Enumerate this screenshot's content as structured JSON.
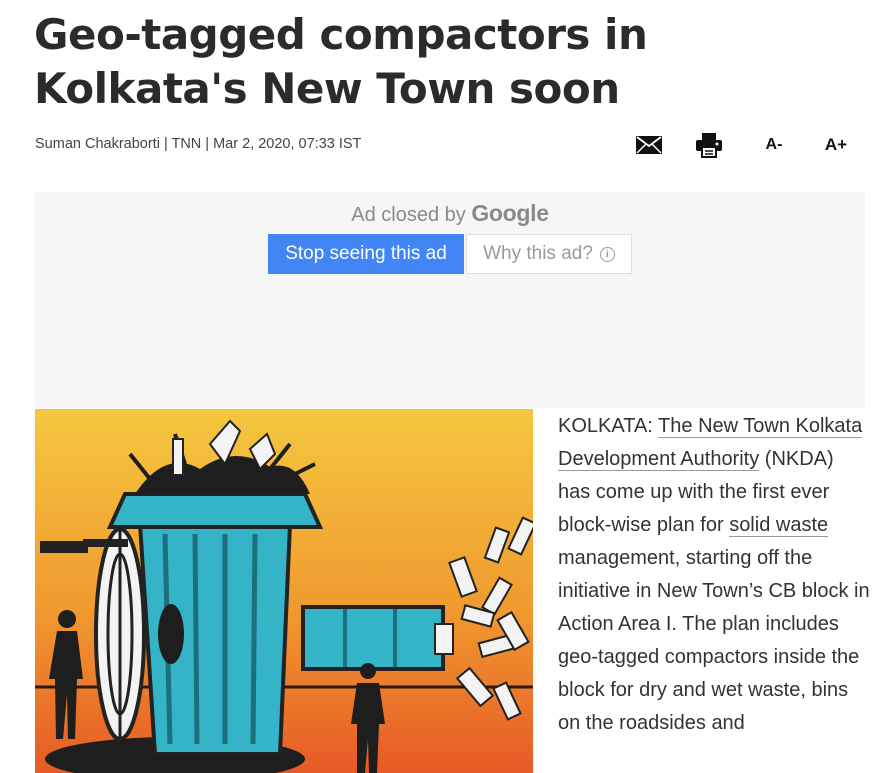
{
  "article": {
    "headline": "Geo-tagged compactors in Kolkata's New Town soon",
    "byline": "Suman Chakraborti | TNN | Mar 2, 2020, 07:33 IST",
    "body_parts": {
      "p1": "KOLKATA: ",
      "link1": "The New Town Kolkata Development Authority",
      "p2": " (NKDA) has come up with the first ever block-wise plan for ",
      "link2": "solid waste",
      "p3": " management, starting off the initiative in New Town’s CB block in Action Area I. The plan includes geo-tagged compactors inside the block for dry and wet waste, bins on the roadsides and"
    }
  },
  "tools": {
    "email_icon": "envelope-icon",
    "print_icon": "printer-icon",
    "font_decrease": "A-",
    "font_increase": "A+"
  },
  "ad": {
    "closed_prefix": "Ad closed by ",
    "closed_brand": "Google",
    "stop_button": "Stop seeing this ad",
    "why_button": "Why this ad?",
    "info_glyph": "i",
    "brand_color": "#4285f4"
  },
  "colors": {
    "illustration_sky_top": "#f3c23a",
    "illustration_sky_bottom": "#e96a2a",
    "bin_color": "#35b3c7",
    "silhouette": "#1e1e1e"
  }
}
